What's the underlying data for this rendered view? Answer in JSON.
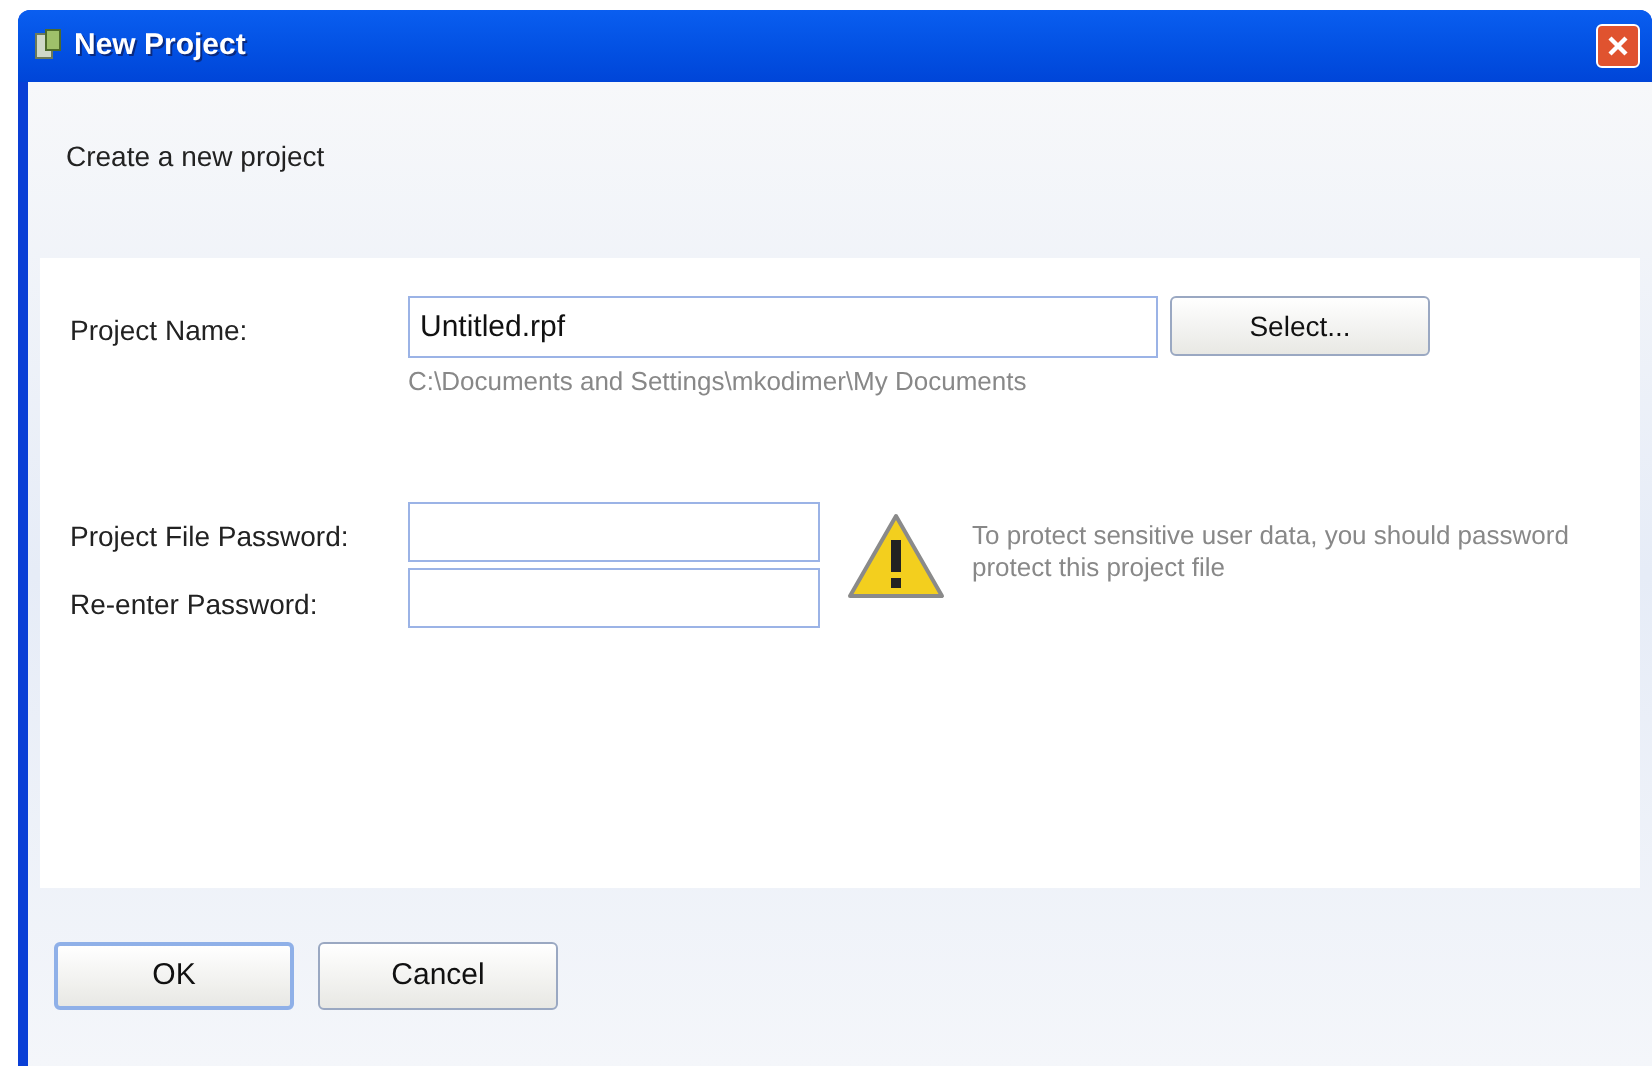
{
  "window": {
    "title": "New Project"
  },
  "header": {
    "text": "Create a new project"
  },
  "project_name": {
    "label": "Project Name:",
    "value": "Untitled.rpf",
    "button": "Select...",
    "path": "C:\\Documents and Settings\\mkodimer\\My Documents"
  },
  "password": {
    "label": "Project File Password:",
    "confirm_label": "Re-enter Password:",
    "warning": "To protect sensitive user data, you should password protect this project file"
  },
  "buttons": [
    {
      "label": "OK",
      "default": true
    },
    {
      "label": "Cancel",
      "default": false
    }
  ]
}
